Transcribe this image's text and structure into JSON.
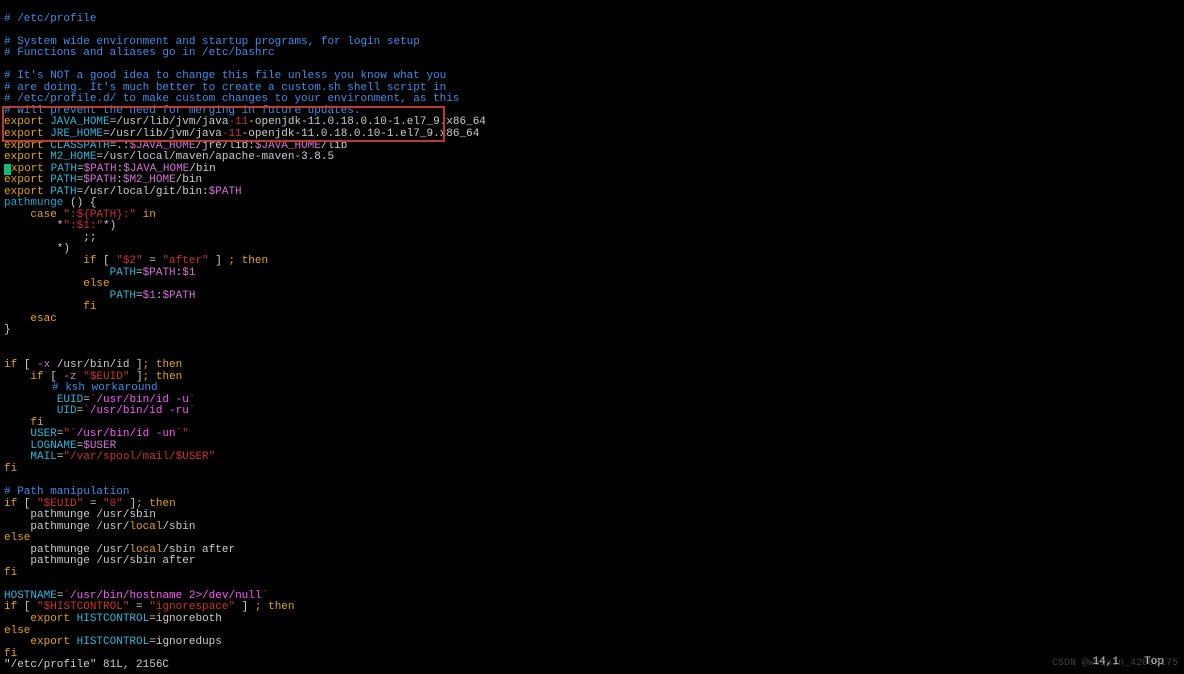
{
  "comments": {
    "c1": "# /etc/profile",
    "c2": "# System wide environment and startup programs, for login setup",
    "c3": "# Functions and aliases go in /etc/bashrc",
    "c4": "# It's NOT a good idea to change this file unless you know what you",
    "c5": "# are doing. It's much better to create a custom.sh shell script in",
    "c6": "# /etc/profile.d/ to make custom changes to your environment, as this",
    "c7": "# will prevent the need for merging in future updates.",
    "c8": "# ksh workaround",
    "c9": "# Path manipulation"
  },
  "exports": {
    "java_home_kw": "export",
    "java_home_var": " JAVA_HOME",
    "java_home_eq": "=",
    "java_home_p1": "/usr/lib/jvm/java",
    "java_home_red": "-11",
    "java_home_p2": "-openjdk-11.0.18.0.10-1.el7_9.x86_64",
    "jre_home_kw": "export",
    "jre_home_var": " JRE_HOME",
    "jre_home_eq": "=",
    "jre_home_p1": "/usr/lib/jvm/java",
    "jre_home_red": "-11",
    "jre_home_p2": "-openjdk-11.0.18.0.10-1.el7_9.x86_64",
    "classpath_kw": "export",
    "classpath_var": " CLASSPATH",
    "classpath_eq": "=",
    "classpath_p1": ".:",
    "classpath_v1": "$JAVA_HOME",
    "classpath_p2": "/jre/lib:",
    "classpath_v2": "$JAVA_HOME",
    "classpath_p3": "/lib",
    "m2_kw": "export",
    "m2_var": " M2_HOME",
    "m2_eq": "=",
    "m2_path": "/usr/local/maven/apache-maven-3.8.5",
    "p1_kw": "xport",
    "p1_var": " PATH",
    "p1_eq": "=",
    "p1_v1": "$PATH",
    "p1_col": ":",
    "p1_v2": "$JAVA_HOME",
    "p1_tail": "/bin",
    "p2_kw": "export",
    "p2_var": " PATH",
    "p2_eq": "=",
    "p2_v1": "$PATH",
    "p2_col": ":",
    "p2_v2": "$M2_HOME",
    "p2_tail": "/bin",
    "p3_kw": "export",
    "p3_var": " PATH",
    "p3_eq": "=",
    "p3_path": "/usr/local/git/bin:",
    "p3_v": "$PATH"
  },
  "func": {
    "name": "pathmunge",
    "open": " () {",
    "case": "    case ",
    "case_str": "\":${PATH}:\"",
    "case_in": " in",
    "pat1a": "        *",
    "pat1b": "\":$1:\"",
    "pat1c": "*)",
    "semi": "            ;;",
    "pat2": "        *)",
    "if1": "            if ",
    "if1b": "[ ",
    "if1c": "\"$2\"",
    "if1d": " = ",
    "if1e": "\"after\"",
    "if1f": " ] ",
    "if1g": "; then",
    "assign1a": "                ",
    "assign1b": "PATH",
    "assign1c": "=",
    "assign1d": "$PATH",
    "assign1e": ":",
    "assign1f": "$1",
    "else1": "            else",
    "assign2a": "                ",
    "assign2b": "PATH",
    "assign2c": "=",
    "assign2d": "$1",
    "assign2e": ":",
    "assign2f": "$PATH",
    "fi1": "            fi",
    "esac": "    esac",
    "close": "}"
  },
  "block2": {
    "if_open": "if ",
    "if_b": "[ ",
    "if_opt": "-x",
    "if_path": " /usr/bin/id ",
    "if_c": "]",
    "if_then": "; then",
    "if2_open": "    if ",
    "if2_b": "[ ",
    "if2_opt": "-z",
    "if2_sp": " ",
    "if2_var": "\"$EUID\"",
    "if2_sp2": " ",
    "if2_c": "]",
    "if2_then": "; then",
    "euid_a": "        ",
    "euid_b": "EUID",
    "euid_c": "=",
    "euid_d": "`",
    "euid_e": "/usr/bin/id -u",
    "euid_f": "`",
    "uid_a": "        ",
    "uid_b": "UID",
    "uid_c": "=",
    "uid_d": "`",
    "uid_e": "/usr/bin/id -ru",
    "uid_f": "`",
    "fi2": "    fi",
    "user_a": "    ",
    "user_b": "USER",
    "user_c": "=",
    "user_d": "\"",
    "user_e": "`",
    "user_f": "/usr/bin/id -un",
    "user_g": "`",
    "user_h": "\"",
    "log_a": "    ",
    "log_b": "LOGNAME",
    "log_c": "=",
    "log_d": "$USER",
    "mail_a": "    ",
    "mail_b": "MAIL",
    "mail_c": "=",
    "mail_d": "\"/var/spool/mail/$USER\"",
    "fi": "fi"
  },
  "block3": {
    "if_open": "if ",
    "if_b": "[ ",
    "if_var": "\"$EUID\"",
    "if_eq": " = ",
    "if_zero": "\"0\"",
    "if_c": " ]",
    "if_then": "; then",
    "pm1": "    pathmunge /usr/sbin",
    "pm2a": "    pathmunge /usr/",
    "pm2b": "local",
    "pm2c": "/sbin",
    "else": "else",
    "pm3a": "    pathmunge /usr/",
    "pm3b": "local",
    "pm3c": "/sbin after",
    "pm4": "    pathmunge /usr/sbin after",
    "fi": "fi"
  },
  "block4": {
    "host_a": "HOSTNAME",
    "host_b": "=",
    "host_c": "`",
    "host_d": "/usr/bin/hostname ",
    "host_e": "2>",
    "host_f": "/dev/null",
    "host_g": "`",
    "if_open": "if ",
    "if_b": "[ ",
    "if_var": "\"$HISTCONTROL\"",
    "if_eq": " = ",
    "if_val": "\"ignorespace\"",
    "if_c": " ] ",
    "if_then": "; then",
    "exp1a": "    export ",
    "exp1b": "HISTCONTROL",
    "exp1c": "=",
    "exp1d": "ignoreboth",
    "else": "else",
    "exp2a": "    export ",
    "exp2b": "HISTCONTROL",
    "exp2c": "=",
    "exp2d": "ignoredups",
    "fi": "fi"
  },
  "status": {
    "file": "\"/etc/profile\" 81L, 2156C",
    "pos": "14,1",
    "loc": "Top"
  },
  "watermark": "CSDN @weixin_42000175"
}
